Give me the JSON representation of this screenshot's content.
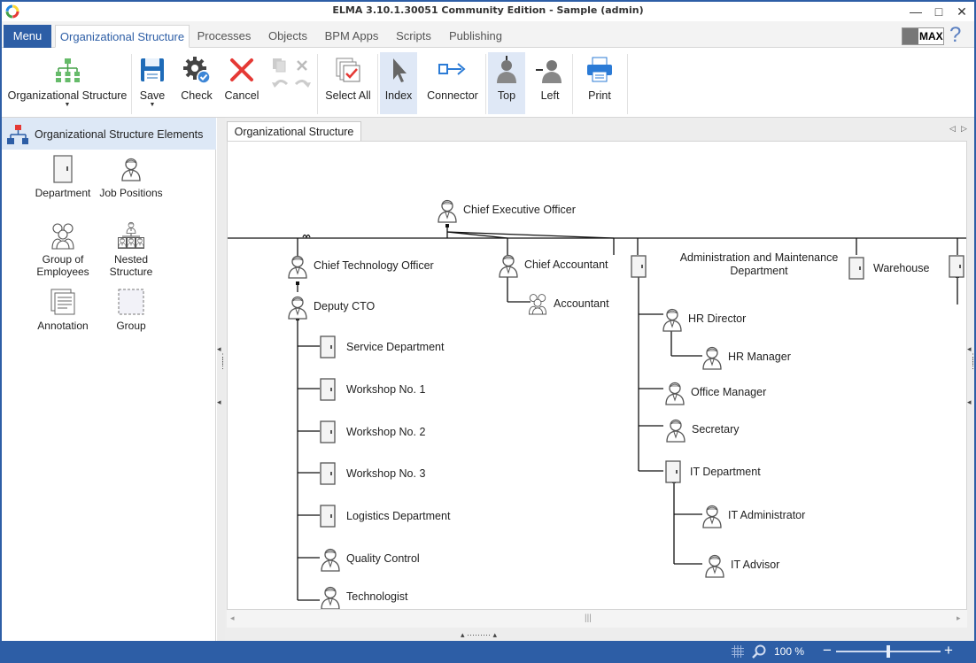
{
  "window": {
    "title": "ELMA 3.10.1.30051 Community Edition - Sample (admin)",
    "minimize": "—",
    "maximize": "□",
    "close": "✕"
  },
  "menu_label": "Menu",
  "tabs": [
    {
      "label": "Organizational Structure",
      "active": true
    },
    {
      "label": "Processes"
    },
    {
      "label": "Objects"
    },
    {
      "label": "BPM Apps"
    },
    {
      "label": "Scripts"
    },
    {
      "label": "Publishing"
    }
  ],
  "max_label": "MAX",
  "help_label": "?",
  "ribbon": {
    "org_structure": "Organizational Structure",
    "save": "Save",
    "check": "Check",
    "cancel": "Cancel",
    "select_all": "Select All",
    "index": "Index",
    "connector": "Connector",
    "top": "Top",
    "left": "Left",
    "print": "Print",
    "dropdown_arrow": "▼"
  },
  "palette": {
    "header": "Organizational Structure Elements",
    "items": [
      {
        "label": "Department",
        "icon": "department-icon"
      },
      {
        "label": "Job Positions",
        "icon": "job-position-icon"
      },
      {
        "label": "Group of Employees",
        "icon": "group-employees-icon"
      },
      {
        "label": "Nested Structure",
        "icon": "nested-structure-icon"
      },
      {
        "label": "Annotation",
        "icon": "annotation-icon"
      },
      {
        "label": "Group",
        "icon": "group-icon"
      }
    ]
  },
  "document_tab": "Organizational Structure",
  "org_chart": {
    "ceo": "Chief Executive Officer",
    "cto": "Chief Technology Officer",
    "deputy_cto": "Deputy CTO",
    "service_dept": "Service Department",
    "workshop1": "Workshop No. 1",
    "workshop2": "Workshop No. 2",
    "workshop3": "Workshop No. 3",
    "logistics": "Logistics Department",
    "quality": "Quality Control",
    "technologist": "Technologist",
    "chief_accountant": "Chief Accountant",
    "accountant": "Accountant",
    "admin_maint": "Administration and Maintenance Department",
    "hr_director": "HR Director",
    "hr_manager": "HR Manager",
    "office_manager": "Office Manager",
    "secretary": "Secretary",
    "it_dept": "IT Department",
    "it_admin": "IT Administrator",
    "it_advisor": "IT Advisor",
    "warehouse": "Warehouse"
  },
  "status": {
    "zoom": "100 %",
    "zoom_minus": "−",
    "zoom_plus": "+",
    "zoom_level": 0.5
  },
  "colors": {
    "accent": "#2d5ea6",
    "ribbon_highlight": "#dfe8f6"
  }
}
